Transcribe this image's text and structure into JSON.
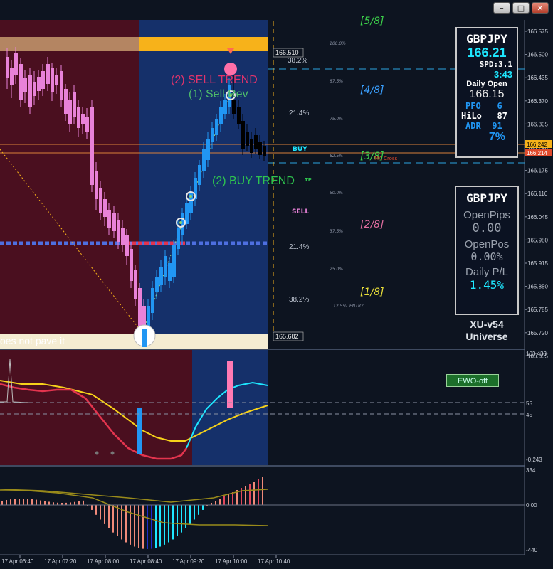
{
  "window": {
    "minimize_glyph": "–",
    "maximize_glyph": "□",
    "close_glyph": "✕"
  },
  "chart": {
    "fibo_left": [
      "38.2%",
      "21.4%",
      "21.4%",
      "38.2%"
    ],
    "fibo_pct": [
      "100.0%",
      "87.5%",
      "75.0%",
      "62.5%",
      "50.0%",
      "37.5%",
      "25.0%",
      "12.5%"
    ],
    "octaves": [
      "[5/8]",
      "[4/8]",
      "[3/8]",
      "[2/8]",
      "[1/8]"
    ],
    "signal_sell_trend": "(2) SELL TREND",
    "signal_sell_rev": "(1) Sell Rev",
    "signal_buy_trend": "(2) BUY TREND",
    "buy_label": "BUY",
    "sell_label": "SELL",
    "sl_label": "SL",
    "tp_label": "TP",
    "entry_label": "ENTRY",
    "ma_label": "MA Cross",
    "ticker_text": "oes not pave it",
    "price_box_top": "166.510",
    "price_box_bottom": "165.682",
    "price_tag_1": "166.242",
    "price_tag_2": "166.214",
    "price_axis": [
      "166.575",
      "166.500",
      "166.435",
      "166.370",
      "166.305",
      "166.240",
      "166.175",
      "166.110",
      "166.045",
      "165.980",
      "165.915",
      "165.850",
      "165.785",
      "165.720",
      "165.655"
    ]
  },
  "info_panel": {
    "symbol": "GBPJPY",
    "price": "166.21",
    "spread": "SPD:3.1",
    "timer": "3:43",
    "daily_open_label": "Daily Open",
    "daily_open": "166.15",
    "pfo_label": "PFO",
    "pfo": "6",
    "hilo_label": "HiLo",
    "hilo": "87",
    "adr_label": "ADR",
    "adr": "91",
    "adr_pct": "7%"
  },
  "account_panel": {
    "symbol": "GBPJPY",
    "open_pips_label": "OpenPips",
    "open_pips": "0.00",
    "open_pos_label": "OpenPos",
    "open_pos": "0.00%",
    "daily_pl_label": "Daily P/L",
    "daily_pl": "1.45%"
  },
  "brand": {
    "line1": "XU-v54",
    "line2": "Universe"
  },
  "ewo_button": "EWO-off",
  "osc1_axis": [
    "103.433",
    "55",
    "45",
    "-0.243"
  ],
  "osc2_axis": [
    "334",
    "0.00",
    "-440"
  ],
  "time_axis": [
    "17 Apr 06:40",
    "17 Apr 07:20",
    "17 Apr 08:00",
    "17 Apr 08:40",
    "17 Apr 09:20",
    "17 Apr 10:00",
    "17 Apr 10:40"
  ],
  "colors": {
    "bull": "#2196f3",
    "bear_candle": "#e882d8",
    "sell": "#e0336b",
    "buy": "#2ec44f",
    "cyan": "#1ee7ff",
    "gold": "#f7b21a"
  }
}
